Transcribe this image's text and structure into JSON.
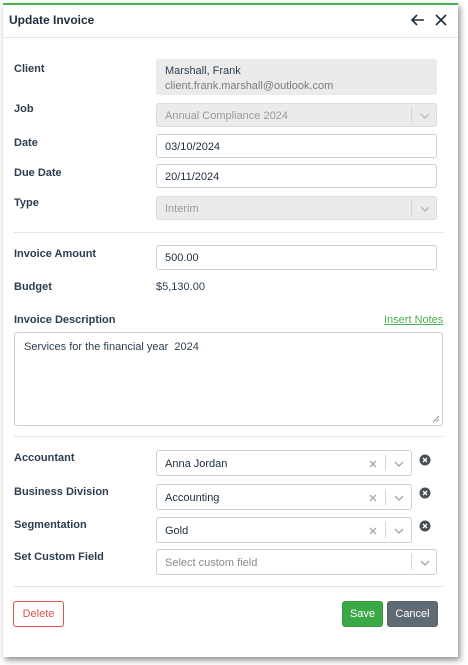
{
  "dialog": {
    "title": "Update Invoice",
    "back_icon": "arrow-left-icon",
    "close_icon": "close-icon"
  },
  "form": {
    "client": {
      "label": "Client",
      "name": "Marshall, Frank",
      "email": "client.frank.marshall@outlook.com"
    },
    "job": {
      "label": "Job",
      "value": "Annual Compliance 2024"
    },
    "date": {
      "label": "Date",
      "value": "03/10/2024"
    },
    "due_date": {
      "label": "Due Date",
      "value": "20/11/2024"
    },
    "type": {
      "label": "Type",
      "value": "Interim"
    },
    "invoice_amount": {
      "label": "Invoice Amount",
      "value": "500.00"
    },
    "budget": {
      "label": "Budget",
      "value": "$5,130.00"
    },
    "invoice_description": {
      "label": "Invoice Description",
      "insert_notes": "Insert Notes",
      "value": "Services for the financial year  2024"
    },
    "accountant": {
      "label": "Accountant",
      "value": "Anna Jordan"
    },
    "business_division": {
      "label": "Business Division",
      "value": "Accounting"
    },
    "segmentation": {
      "label": "Segmentation",
      "value": "Gold"
    },
    "custom_field": {
      "label": "Set Custom Field",
      "placeholder": "Select custom field"
    }
  },
  "footer": {
    "delete_label": "Delete",
    "save_label": "Save",
    "cancel_label": "Cancel"
  },
  "colors": {
    "accent": "#4caf50",
    "save": "#3aa845",
    "cancel": "#5f6b74",
    "delete": "#d9534f"
  }
}
